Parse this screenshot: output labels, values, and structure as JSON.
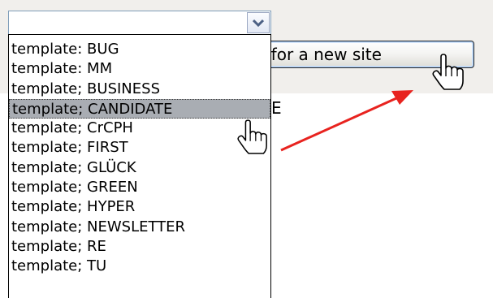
{
  "select": {
    "value": "",
    "options": [
      "template: BUG",
      "template: MM",
      "template; BUSINESS",
      "template; CANDIDATE",
      "template; CrCPH",
      "template; FIRST",
      "template; GLÜCK",
      "template; GREEN",
      "template; HYPER",
      "template; NEWSLETTER",
      "template; RE",
      "template; TU"
    ],
    "selected_index": 3
  },
  "page": {
    "button_label": "e for a new site",
    "partial_text": "E"
  },
  "colors": {
    "highlight": "#a9adb3",
    "annotation_arrow": "#e8231f",
    "panel_bg": "#f1efec"
  },
  "icons": [
    "chevron-down-icon",
    "hand-cursor-icon",
    "red-arrow-annotation"
  ]
}
